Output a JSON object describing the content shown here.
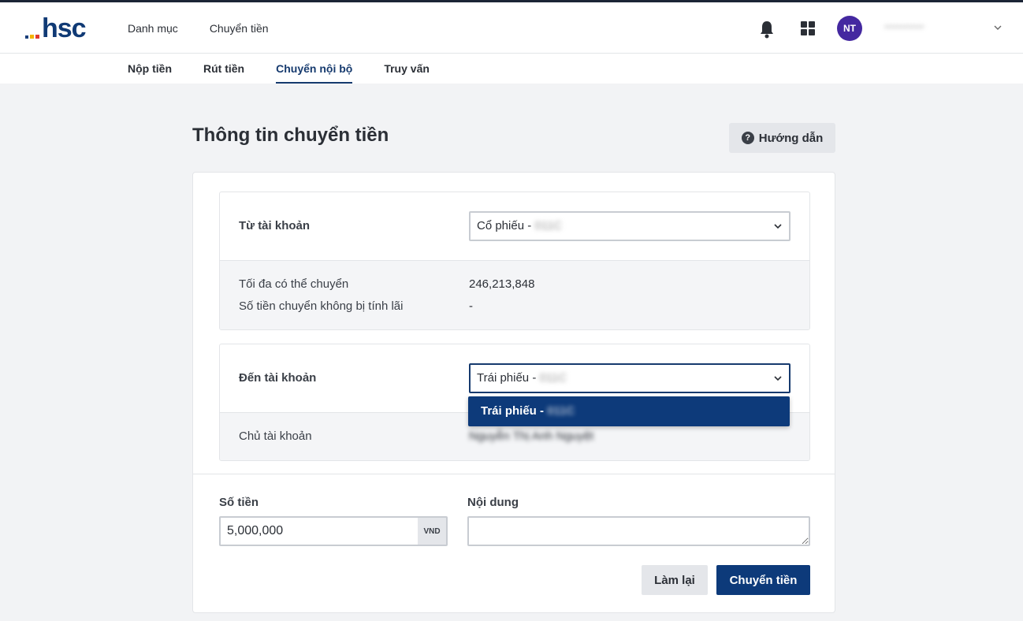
{
  "brand": {
    "logo_text": "hsc",
    "dot_colors": [
      "#e03a2f",
      "#f4b400",
      "#1a3f7a"
    ]
  },
  "main_nav": [
    "Danh mục",
    "Chuyển tiền"
  ],
  "user": {
    "initials": "NT",
    "name_masked": "••••••••••••"
  },
  "sub_nav": {
    "items": [
      "Nộp tiền",
      "Rút tiền",
      "Chuyển nội bộ",
      "Truy vấn"
    ],
    "active": "Chuyển nội bộ"
  },
  "page": {
    "title": "Thông tin chuyển tiền",
    "guide_label": "Hướng dẫn",
    "guide_icon": "?"
  },
  "from_account": {
    "label": "Từ tài khoản",
    "selected_prefix": "Cổ phiếu - ",
    "selected_masked": "011C",
    "max_transfer_label": "Tối đa có thể chuyển",
    "max_transfer_value": "246,213,848",
    "no_interest_label": "Số tiền chuyển không bị tính lãi",
    "no_interest_value": "-"
  },
  "to_account": {
    "label": "Đến tài khoản",
    "selected_prefix": "Trái phiếu - ",
    "selected_masked": "011C",
    "owner_label": "Chủ tài khoản",
    "owner_masked": "Nguyễn Thị Anh Nguyệt",
    "dropdown_options": [
      {
        "prefix": "Trái phiếu - ",
        "masked": "011C"
      }
    ]
  },
  "amount": {
    "label": "Số tiền",
    "value": "5,000,000",
    "unit": "VND"
  },
  "content": {
    "label": "Nội dung",
    "value": ""
  },
  "actions": {
    "reset_label": "Làm lại",
    "submit_label": "Chuyển tiền"
  },
  "colors": {
    "primary": "#0d3a7a",
    "avatar": "#4428a0"
  }
}
